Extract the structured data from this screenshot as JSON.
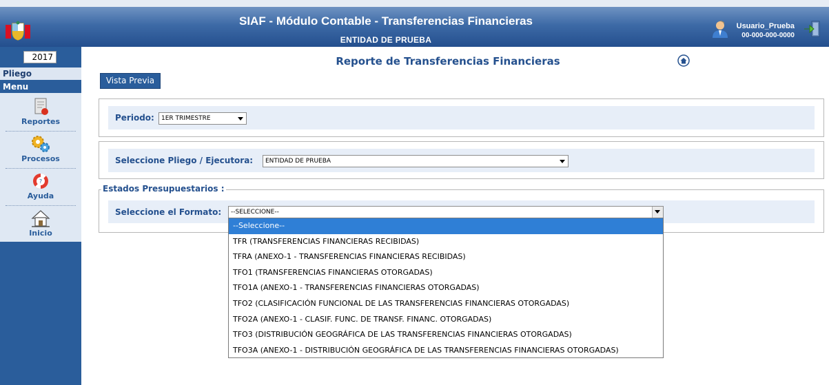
{
  "header": {
    "title": "SIAF - Módulo Contable - Transferencias Financieras",
    "subtitle": "ENTIDAD DE PRUEBA",
    "user_name": "Usuario_Prueba",
    "user_code": "00-000-000-0000"
  },
  "sidebar": {
    "year": "2017",
    "pliego_label": "Pliego",
    "menu_label": "Menu",
    "items": [
      {
        "label": "Reportes",
        "icon": "report-icon"
      },
      {
        "label": "Procesos",
        "icon": "gears-icon"
      },
      {
        "label": "Ayuda",
        "icon": "help-lifebuoy-icon"
      },
      {
        "label": "Inicio",
        "icon": "home-icon"
      }
    ]
  },
  "main": {
    "report_title": "Reporte de Transferencias Financieras",
    "preview_button": "Vista Previa",
    "periodo": {
      "label": "Periodo:",
      "value": "1ER TRIMESTRE"
    },
    "pliego": {
      "label": "Seleccione Pliego / Ejecutora:",
      "value": "ENTIDAD DE PRUEBA"
    },
    "estados": {
      "legend": "Estados Presupuestarios :",
      "formato_label": "Seleccione el Formato:",
      "formato_value": "--SELECCIONE--",
      "options": [
        "--Seleccione--",
        "TFR (TRANSFERENCIAS FINANCIERAS RECIBIDAS)",
        "TFRA (ANEXO-1 - TRANSFERENCIAS FINANCIERAS RECIBIDAS)",
        "TFO1 (TRANSFERENCIAS FINANCIERAS OTORGADAS)",
        "TFO1A (ANEXO-1 - TRANSFERENCIAS FINANCIERAS OTORGADAS)",
        "TFO2 (CLASIFICACIÓN FUNCIONAL DE LAS TRANSFERENCIAS FINANCIERAS OTORGADAS)",
        "TFO2A (ANEXO-1 - CLASIF. FUNC. DE TRANSF. FINANC. OTORGADAS)",
        "TFO3 (DISTRIBUCIÓN GEOGRÁFICA DE LAS TRANSFERENCIAS FINANCIERAS OTORGADAS)",
        "TFO3A (ANEXO-1 - DISTRIBUCIÓN GEOGRÁFICA DE LAS TRANSFERENCIAS FINANCIERAS OTORGADAS)"
      ]
    }
  },
  "colors": {
    "header_blue": "#3d6aa6",
    "sidebar_blue": "#2a5d9b",
    "label_blue": "#24508e",
    "band": "#e7eef8",
    "selected_option": "#2f7fd6"
  }
}
